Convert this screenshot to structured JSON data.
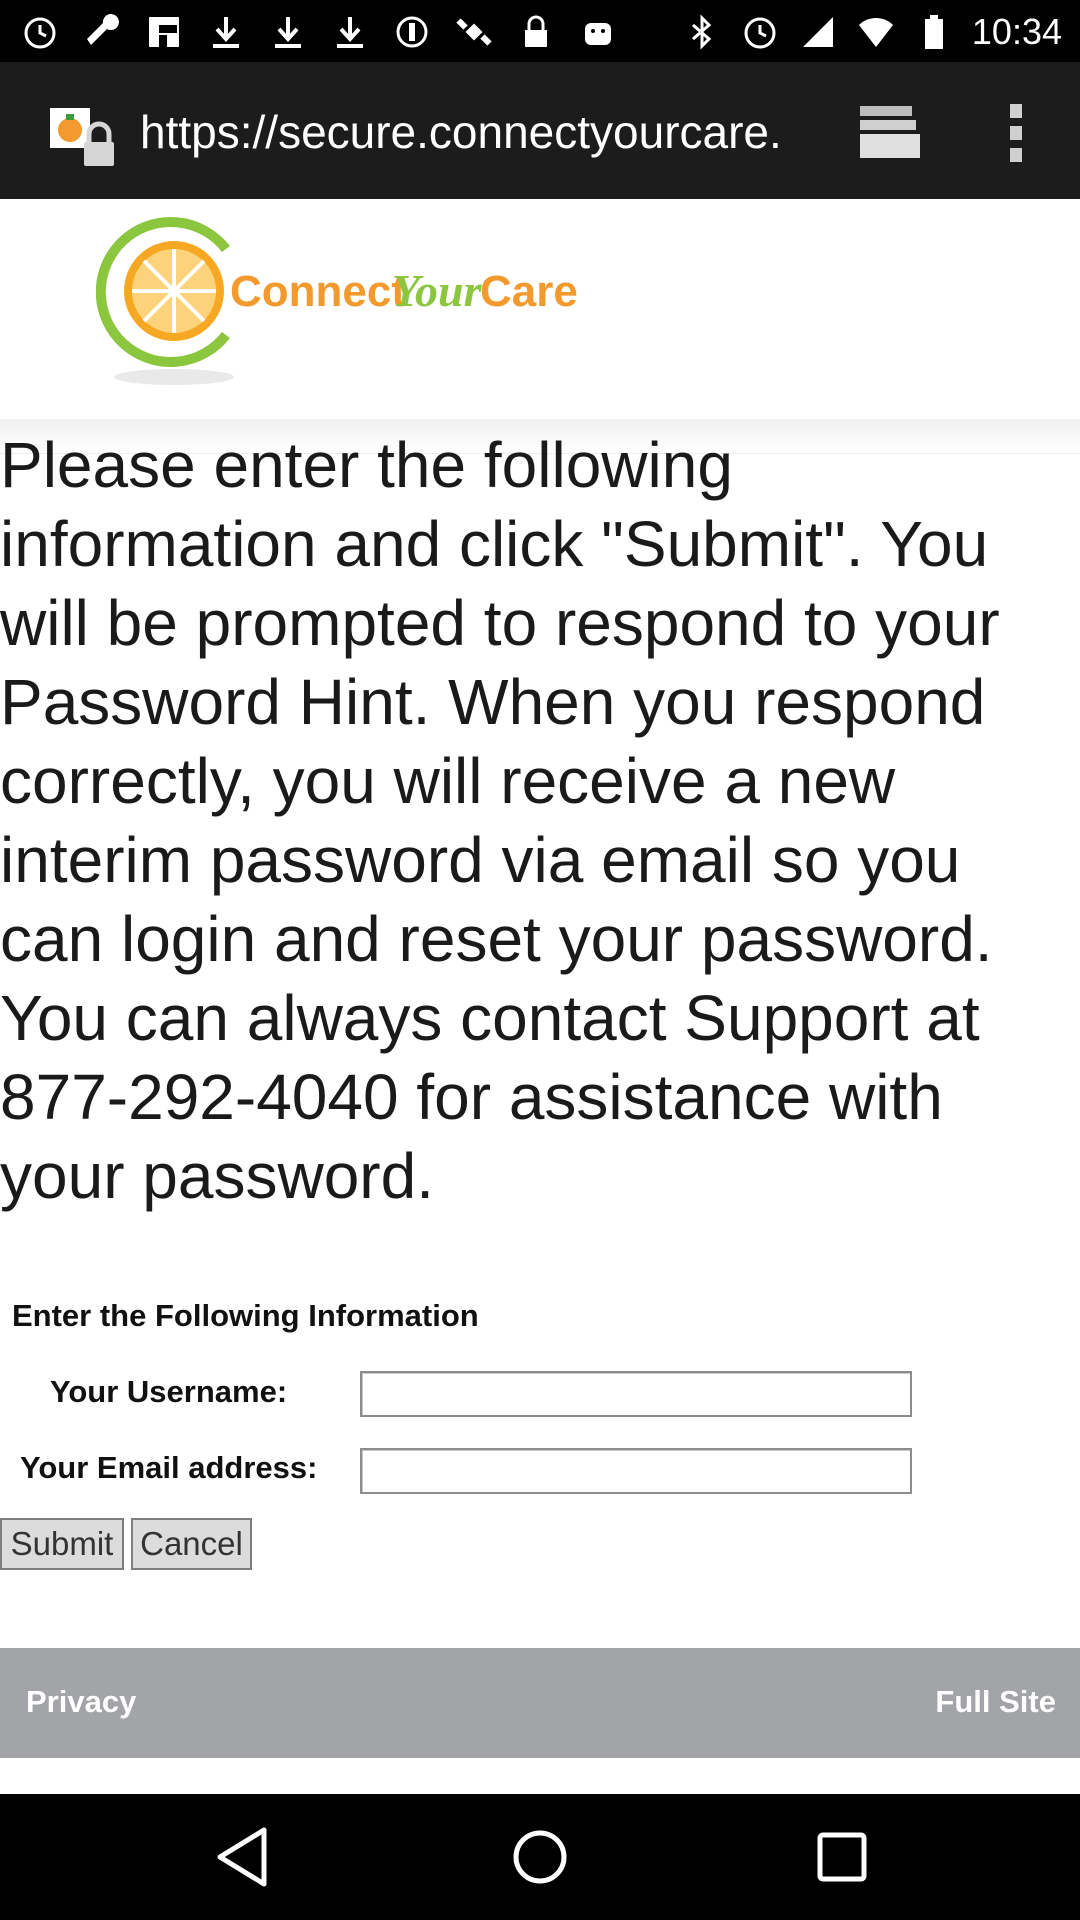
{
  "status_bar": {
    "time": "10:34",
    "left_icons": [
      "alarm-icon",
      "wrench-icon",
      "flipboard-icon",
      "download-icon",
      "download-icon",
      "download-icon",
      "info-circle-icon",
      "satellite-icon",
      "lock-icon",
      "android-icon"
    ],
    "right_icons": [
      "bluetooth-icon",
      "alarm-icon",
      "signal-icon",
      "wifi-icon",
      "battery-icon"
    ]
  },
  "browser": {
    "url": "https://secure.connectyourcare.",
    "tabs_icon": "tabs-icon",
    "menu_icon": "more-vert-icon"
  },
  "header": {
    "logo_text_1": "Connect",
    "logo_text_2": "Your",
    "logo_text_3": "Care"
  },
  "intro": {
    "text": "Please enter the following information and click \"Submit\". You will be prompted to respond to your Password Hint. When you respond correctly, you will receive a new interim password via email so you can login and reset your password. You can always contact Support at 877-292-4040 for assistance with your password."
  },
  "form": {
    "title": "Enter the Following Information",
    "username_label": "Your Username:",
    "username_value": "",
    "email_label": "Your Email address:",
    "email_value": "",
    "submit_label": "Submit",
    "cancel_label": "Cancel"
  },
  "footer": {
    "privacy_label": "Privacy",
    "full_site_label": "Full Site"
  },
  "colors": {
    "footer_bg": "#a3a4a8",
    "logo_orange": "#f5a623",
    "logo_green": "#8cc63f",
    "browser_bg": "#1c1c1c"
  }
}
